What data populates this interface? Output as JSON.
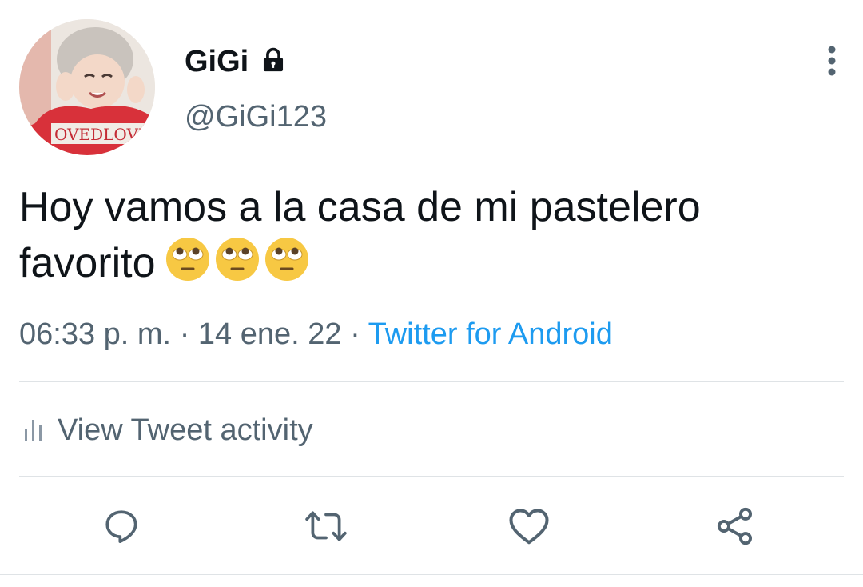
{
  "author": {
    "display_name": "GiGi",
    "handle": "@GiGi123",
    "protected_icon": "lock-icon",
    "avatar_text": "OVEDLOVE"
  },
  "tweet": {
    "text": "Hoy vamos a la casa de mi pastelero favorito",
    "emojis": [
      "face-with-rolling-eyes",
      "face-with-rolling-eyes",
      "face-with-rolling-eyes"
    ]
  },
  "meta": {
    "time": "06:33 p. m.",
    "separator": "·",
    "date": "14 ene. 22",
    "source": "Twitter for Android"
  },
  "activity": {
    "label": "View Tweet activity",
    "icon": "bar-chart-icon"
  },
  "actions": [
    {
      "name": "reply",
      "icon": "reply-icon"
    },
    {
      "name": "retweet",
      "icon": "retweet-icon"
    },
    {
      "name": "like",
      "icon": "heart-icon"
    },
    {
      "name": "share",
      "icon": "share-icon"
    }
  ],
  "colors": {
    "text": "#0f1419",
    "secondary": "#536471",
    "link": "#1d9bf0",
    "divider": "#dfe3e6",
    "emoji": "#f7c843"
  }
}
